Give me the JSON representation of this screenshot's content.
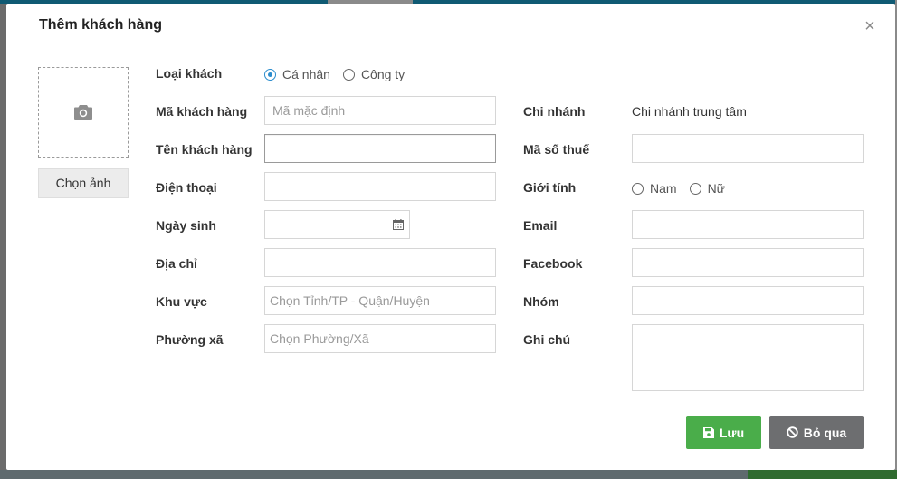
{
  "dialog": {
    "title": "Thêm khách hàng",
    "close_glyph": "×"
  },
  "photo": {
    "icon": "camera-icon",
    "button_label": "Chọn ảnh"
  },
  "form_left": {
    "customer_type": {
      "label": "Loại khách",
      "options": [
        "Cá nhân",
        "Công ty"
      ],
      "selected": "Cá nhân"
    },
    "customer_code": {
      "label": "Mã khách hàng",
      "placeholder": "Mã mặc định",
      "value": ""
    },
    "customer_name": {
      "label": "Tên khách hàng",
      "value": ""
    },
    "phone": {
      "label": "Điện thoại",
      "value": ""
    },
    "birthday": {
      "label": "Ngày sinh",
      "value": "",
      "icon": "calendar-icon"
    },
    "address": {
      "label": "Địa chỉ",
      "value": ""
    },
    "area": {
      "label": "Khu vực",
      "placeholder": "Chọn Tỉnh/TP - Quận/Huyện"
    },
    "ward": {
      "label": "Phường xã",
      "placeholder": "Chọn Phường/Xã"
    }
  },
  "form_right": {
    "branch": {
      "label": "Chi nhánh",
      "value": "Chi nhánh trung tâm"
    },
    "tax_code": {
      "label": "Mã số thuế",
      "value": ""
    },
    "gender": {
      "label": "Giới tính",
      "options": [
        "Nam",
        "Nữ"
      ],
      "selected": ""
    },
    "email": {
      "label": "Email",
      "value": ""
    },
    "facebook": {
      "label": "Facebook",
      "value": ""
    },
    "group": {
      "label": "Nhóm",
      "value": ""
    },
    "note": {
      "label": "Ghi chú",
      "value": ""
    }
  },
  "actions": {
    "save_label": "Lưu",
    "save_icon": "floppy-disk-icon",
    "save_color": "#4aad4a",
    "skip_label": "Bỏ qua",
    "skip_icon": "ban-icon",
    "skip_color": "#6d6e70"
  }
}
